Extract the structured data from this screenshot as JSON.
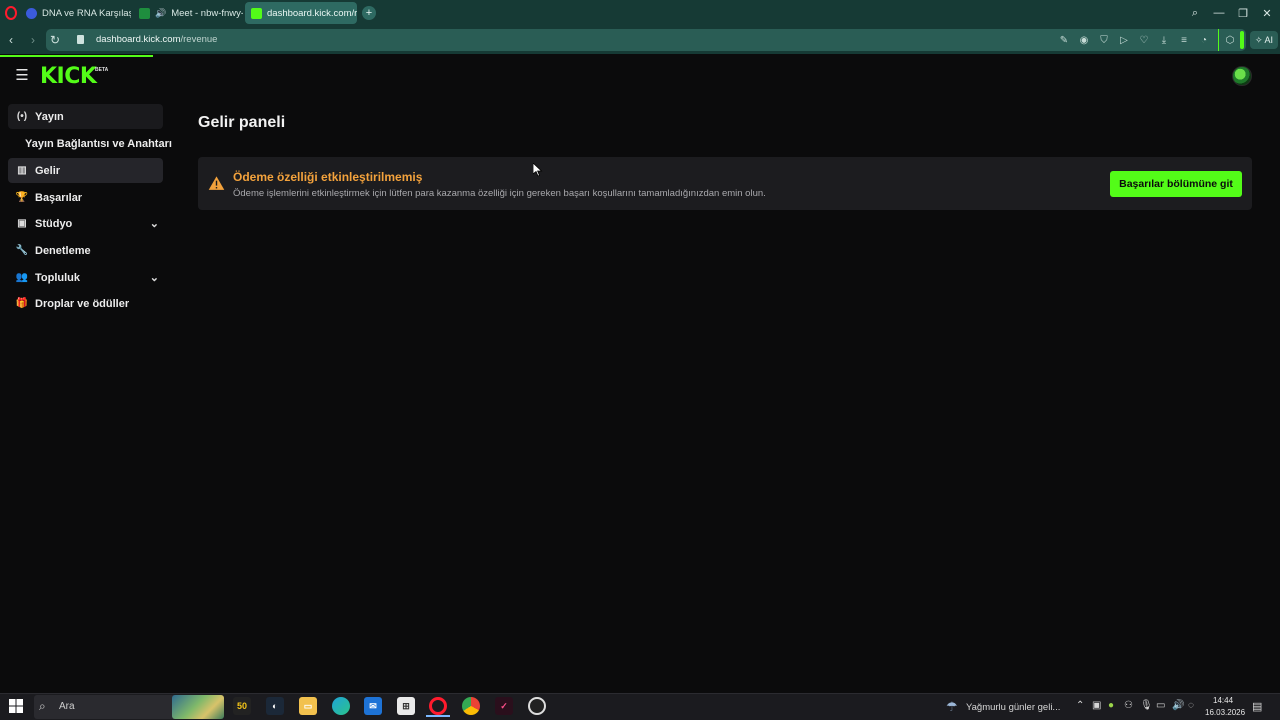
{
  "browser": {
    "tabs": [
      {
        "label": "DNA ve RNA Karşılaştırma",
        "active": false
      },
      {
        "label": "Meet - nbw-fnwy-nkr",
        "active": false
      },
      {
        "label": "dashboard.kick.com/reve",
        "active": true
      }
    ],
    "new_tab_label": "+",
    "url_host": "dashboard.kick.com",
    "url_path": "/revenue",
    "ai_label": "AI"
  },
  "app": {
    "logo_text": "KICK",
    "beta_badge": "BETA",
    "accent_color": "#53fc18"
  },
  "sidebar": {
    "items": [
      {
        "label": "Yayın",
        "icon": "broadcast-icon"
      },
      {
        "label": "Yayın Bağlantısı ve Anahtarı",
        "sub": true
      },
      {
        "label": "Gelir",
        "icon": "revenue-chart-icon",
        "active": true
      },
      {
        "label": "Başarılar",
        "icon": "trophy-icon"
      },
      {
        "label": "Stüdyo",
        "icon": "studio-icon",
        "expandable": true
      },
      {
        "label": "Denetleme",
        "icon": "wrench-icon"
      },
      {
        "label": "Topluluk",
        "icon": "community-icon",
        "expandable": true
      },
      {
        "label": "Droplar ve ödüller",
        "icon": "gift-icon"
      }
    ]
  },
  "main": {
    "title": "Gelir paneli",
    "alert": {
      "title": "Ödeme özelliği etkinleştirilmemiş",
      "description": "Ödeme işlemlerini etkinleştirmek için lütfen para kazanma özelliği için gereken başarı koşullarını tamamladığınızdan emin olun.",
      "button_label": "Başarılar bölümüne git",
      "title_color": "#f3a23c"
    }
  },
  "taskbar": {
    "search_placeholder": "Ara",
    "weather_text": "Yağmurlu günler geli...",
    "time": "14:44",
    "date": "16.03.2026"
  }
}
